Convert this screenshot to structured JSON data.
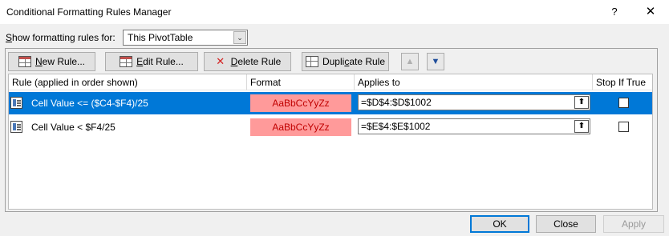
{
  "window": {
    "title": "Conditional Formatting Rules Manager",
    "help_glyph": "?",
    "close_glyph": "✕"
  },
  "scope": {
    "label_key": "S",
    "label_rest": "how formatting rules for:",
    "selected": "This PivotTable",
    "arrow": "⌄"
  },
  "toolbar": {
    "new_key": "N",
    "new_rest": "ew Rule...",
    "edit_key": "E",
    "edit_rest": "dit Rule...",
    "delete_key": "D",
    "delete_rest": "elete Rule",
    "dup_pre": "Dupli",
    "dup_key": "c",
    "dup_post": "ate Rule",
    "move_up_glyph": "▲",
    "move_down_glyph": "▼"
  },
  "columns": {
    "rule": "Rule (applied in order shown)",
    "format": "Format",
    "applies": "Applies to",
    "stop": "Stop If True"
  },
  "rules": [
    {
      "rule": "Cell Value <= ($C4-$F4)/25",
      "format_preview": "AaBbCcYyZz",
      "applies_to": "=$D$4:$D$1002",
      "selected": true
    },
    {
      "rule": "Cell Value < $F4/25",
      "format_preview": "AaBbCcYyZz",
      "applies_to": "=$E$4:$E$1002",
      "selected": false
    }
  ],
  "collapse_glyph": "⬆",
  "footer": {
    "ok": "OK",
    "close": "Close",
    "apply": "Apply"
  },
  "colors": {
    "selection": "#0078d7",
    "format_fill": "#ff9a9a",
    "format_text": "#c00000"
  }
}
